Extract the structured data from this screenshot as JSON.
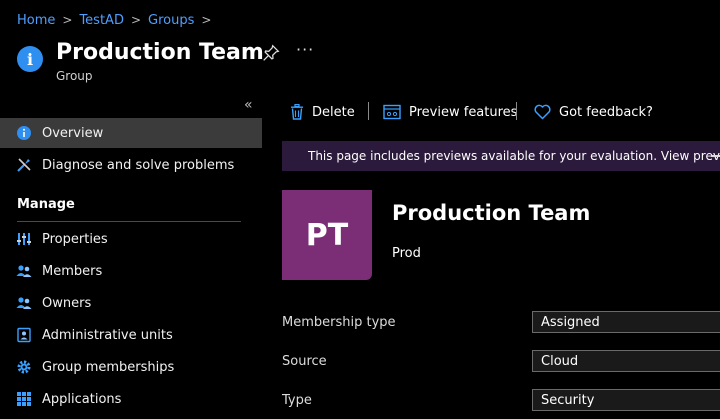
{
  "breadcrumb": {
    "items": [
      "Home",
      "TestAD",
      "Groups"
    ],
    "separator": ">"
  },
  "header": {
    "icon": "info-icon",
    "title": "Production Team",
    "subtitle": "Group",
    "pin_icon": "pin-icon",
    "more_label": "···"
  },
  "sidebar": {
    "collapse_label": "«",
    "items": [
      {
        "label": "Overview",
        "icon": "info-icon",
        "active": true
      },
      {
        "label": "Diagnose and solve problems",
        "icon": "wrench-icon"
      }
    ],
    "section": "Manage",
    "manage_items": [
      {
        "label": "Properties",
        "icon": "properties-icon"
      },
      {
        "label": "Members",
        "icon": "members-icon"
      },
      {
        "label": "Owners",
        "icon": "owners-icon"
      },
      {
        "label": "Administrative units",
        "icon": "admin-units-icon"
      },
      {
        "label": "Group memberships",
        "icon": "gear-icon"
      },
      {
        "label": "Applications",
        "icon": "apps-icon"
      }
    ]
  },
  "toolbar": {
    "delete_label": "Delete",
    "preview_label": "Preview features",
    "feedback_label": "Got feedback?"
  },
  "banner": {
    "text": "This page includes previews available for your evaluation. View previews",
    "icon": "rocket-icon"
  },
  "group": {
    "initials": "PT",
    "name": "Production Team",
    "description": "Prod"
  },
  "properties": [
    {
      "label": "Membership type",
      "value": "Assigned"
    },
    {
      "label": "Source",
      "value": "Cloud"
    },
    {
      "label": "Type",
      "value": "Security"
    }
  ],
  "colors": {
    "background": "#000000",
    "link": "#4f9fff",
    "accent": "#2f8ff0",
    "avatar": "#7b2e76",
    "banner": "#2b1a3b",
    "active_nav": "#3b3b3b"
  }
}
